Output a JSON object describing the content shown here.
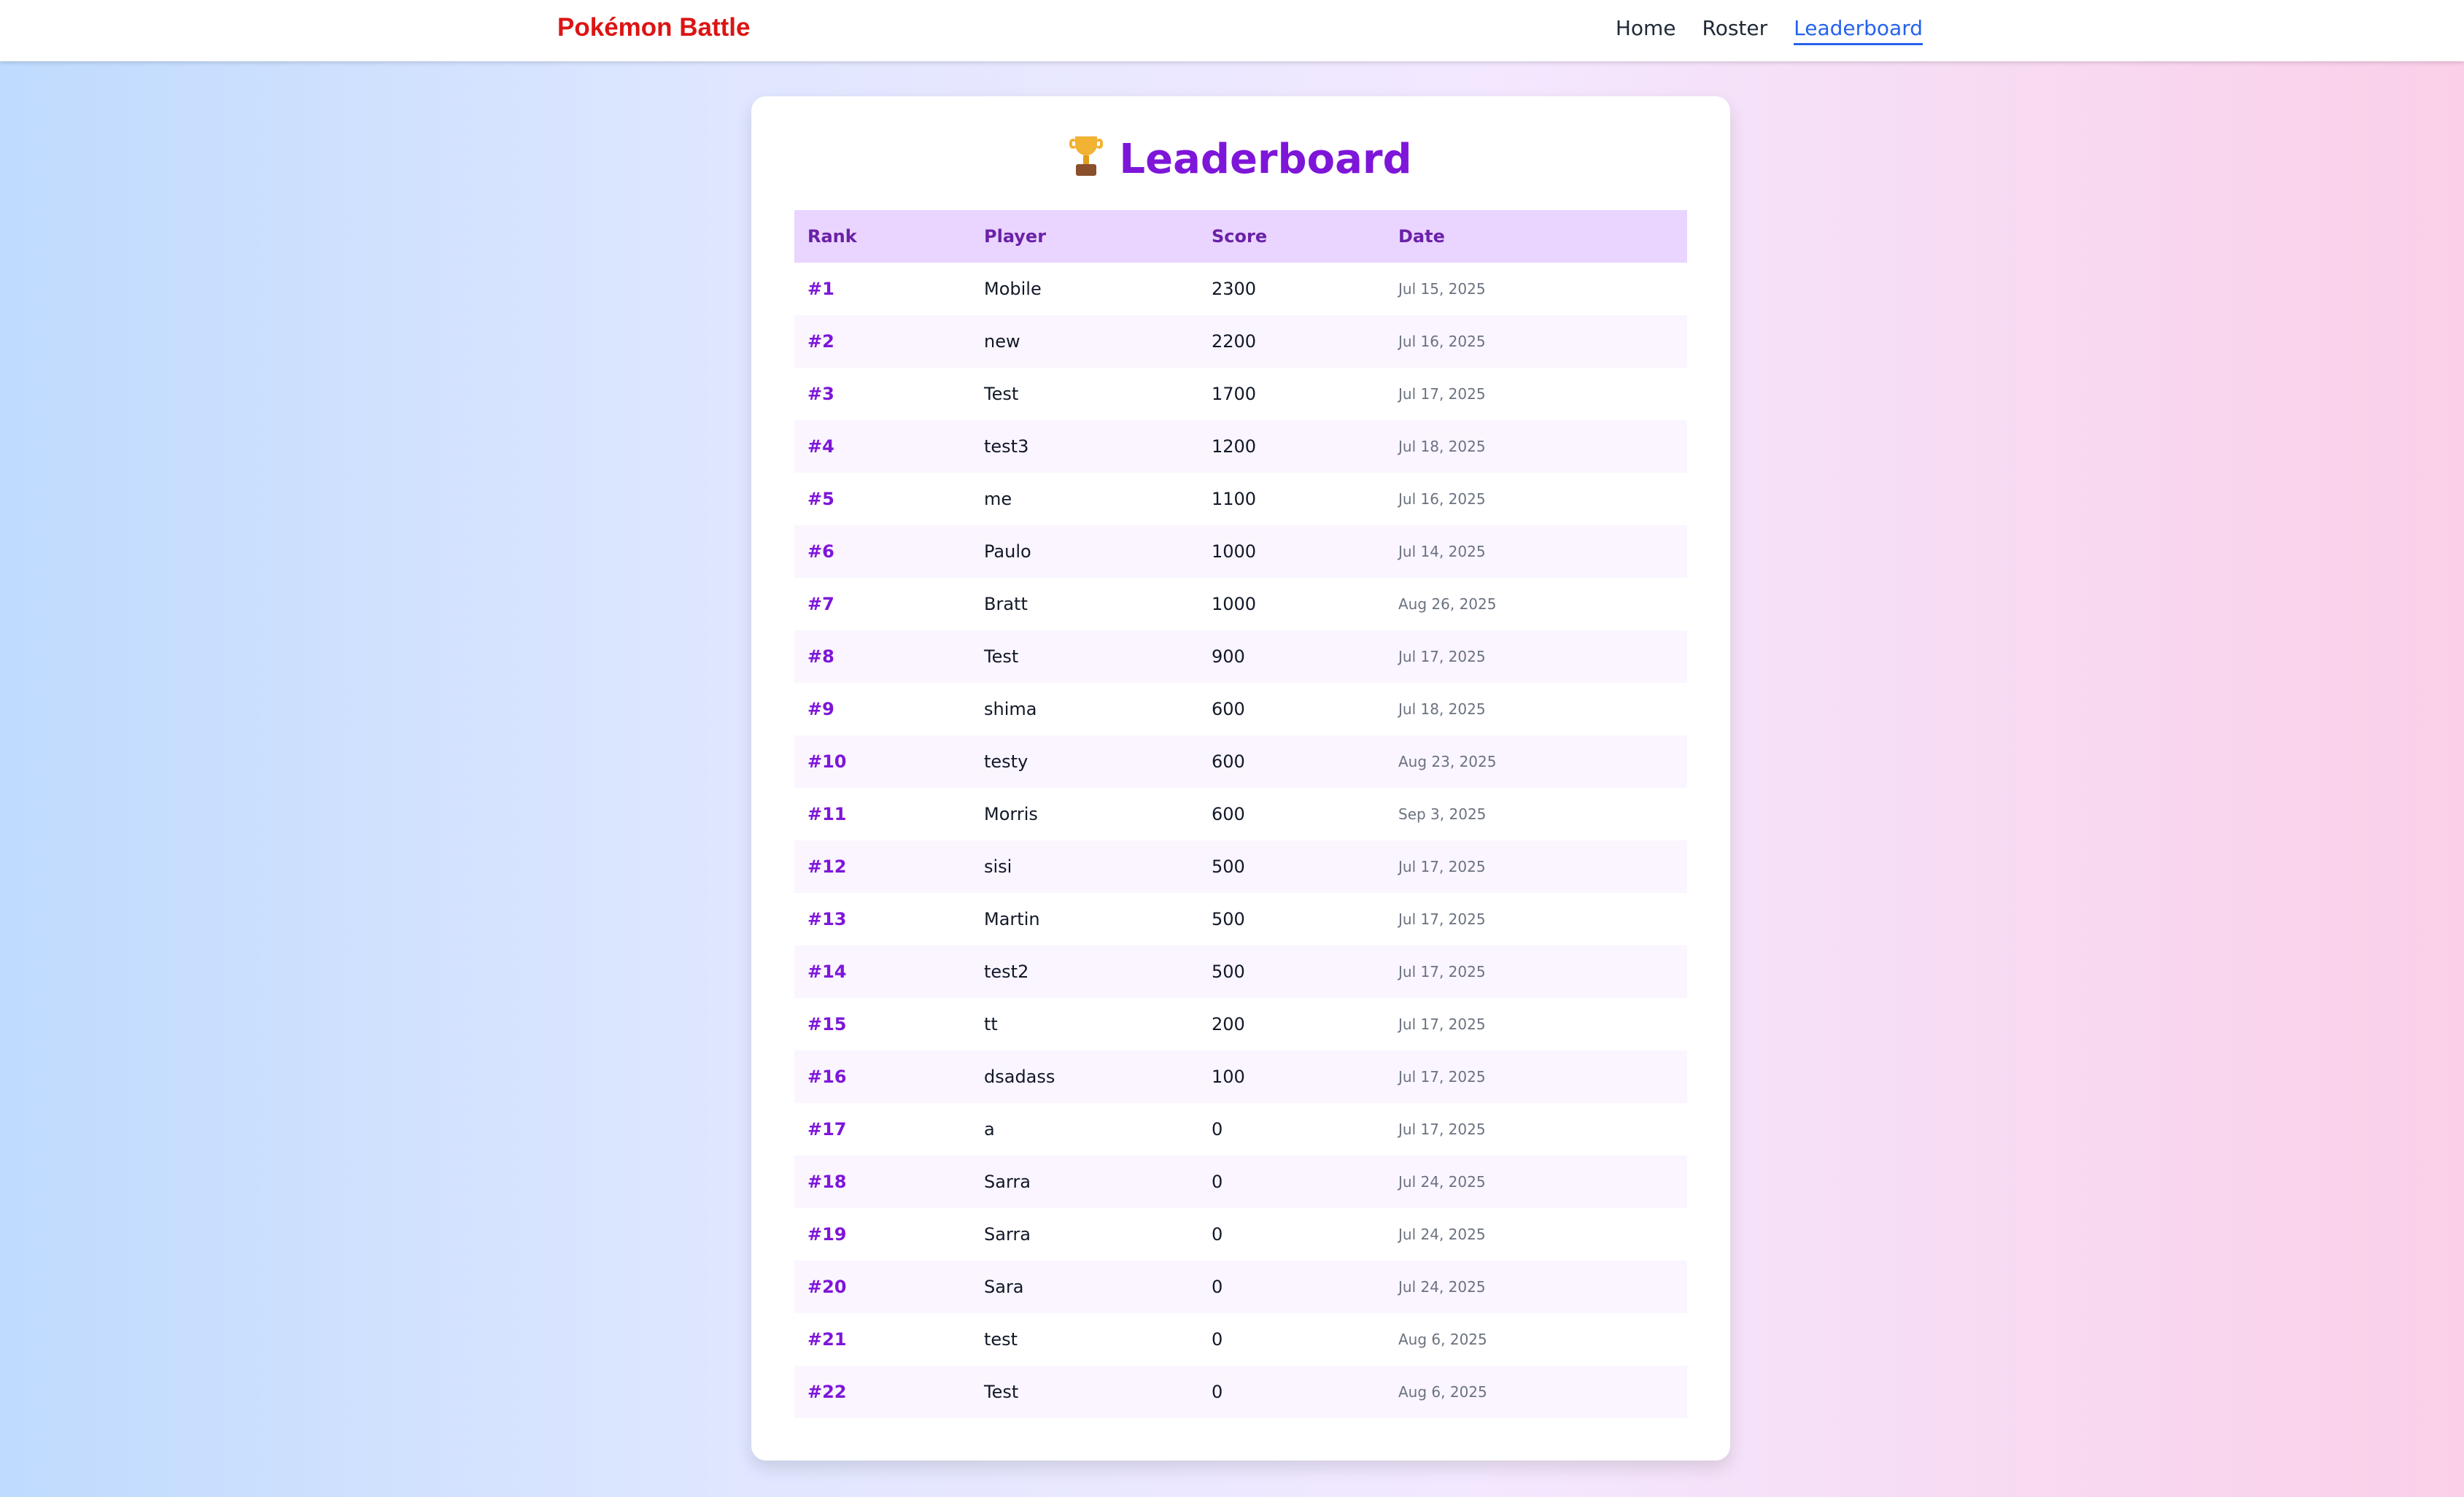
{
  "navbar": {
    "brand": "Pokémon Battle",
    "links": [
      "Home",
      "Roster",
      "Leaderboard"
    ],
    "active": "Leaderboard"
  },
  "page": {
    "title": "Leaderboard",
    "icon": "trophy-icon"
  },
  "table": {
    "headers": [
      "Rank",
      "Player",
      "Score",
      "Date"
    ],
    "rows": [
      {
        "rank": "#1",
        "player": "Mobile",
        "score": "2300",
        "date": "Jul 15, 2025"
      },
      {
        "rank": "#2",
        "player": "new",
        "score": "2200",
        "date": "Jul 16, 2025"
      },
      {
        "rank": "#3",
        "player": "Test",
        "score": "1700",
        "date": "Jul 17, 2025"
      },
      {
        "rank": "#4",
        "player": "test3",
        "score": "1200",
        "date": "Jul 18, 2025"
      },
      {
        "rank": "#5",
        "player": "me",
        "score": "1100",
        "date": "Jul 16, 2025"
      },
      {
        "rank": "#6",
        "player": "Paulo",
        "score": "1000",
        "date": "Jul 14, 2025"
      },
      {
        "rank": "#7",
        "player": "Bratt",
        "score": "1000",
        "date": "Aug 26, 2025"
      },
      {
        "rank": "#8",
        "player": "Test",
        "score": "900",
        "date": "Jul 17, 2025"
      },
      {
        "rank": "#9",
        "player": "shima",
        "score": "600",
        "date": "Jul 18, 2025"
      },
      {
        "rank": "#10",
        "player": "testy",
        "score": "600",
        "date": "Aug 23, 2025"
      },
      {
        "rank": "#11",
        "player": "Morris",
        "score": "600",
        "date": "Sep 3, 2025"
      },
      {
        "rank": "#12",
        "player": "sisi",
        "score": "500",
        "date": "Jul 17, 2025"
      },
      {
        "rank": "#13",
        "player": "Martin",
        "score": "500",
        "date": "Jul 17, 2025"
      },
      {
        "rank": "#14",
        "player": "test2",
        "score": "500",
        "date": "Jul 17, 2025"
      },
      {
        "rank": "#15",
        "player": "tt",
        "score": "200",
        "date": "Jul 17, 2025"
      },
      {
        "rank": "#16",
        "player": "dsadass",
        "score": "100",
        "date": "Jul 17, 2025"
      },
      {
        "rank": "#17",
        "player": "a",
        "score": "0",
        "date": "Jul 17, 2025"
      },
      {
        "rank": "#18",
        "player": "Sarra",
        "score": "0",
        "date": "Jul 24, 2025"
      },
      {
        "rank": "#19",
        "player": "Sarra",
        "score": "0",
        "date": "Jul 24, 2025"
      },
      {
        "rank": "#20",
        "player": "Sara",
        "score": "0",
        "date": "Jul 24, 2025"
      },
      {
        "rank": "#21",
        "player": "test",
        "score": "0",
        "date": "Aug 6, 2025"
      },
      {
        "rank": "#22",
        "player": "Test",
        "score": "0",
        "date": "Aug 6, 2025"
      }
    ]
  },
  "colors": {
    "brand": "#dc1414",
    "accent": "#7e16d9",
    "nav_active": "#2563eb",
    "header_bg": "#e9d5ff"
  }
}
